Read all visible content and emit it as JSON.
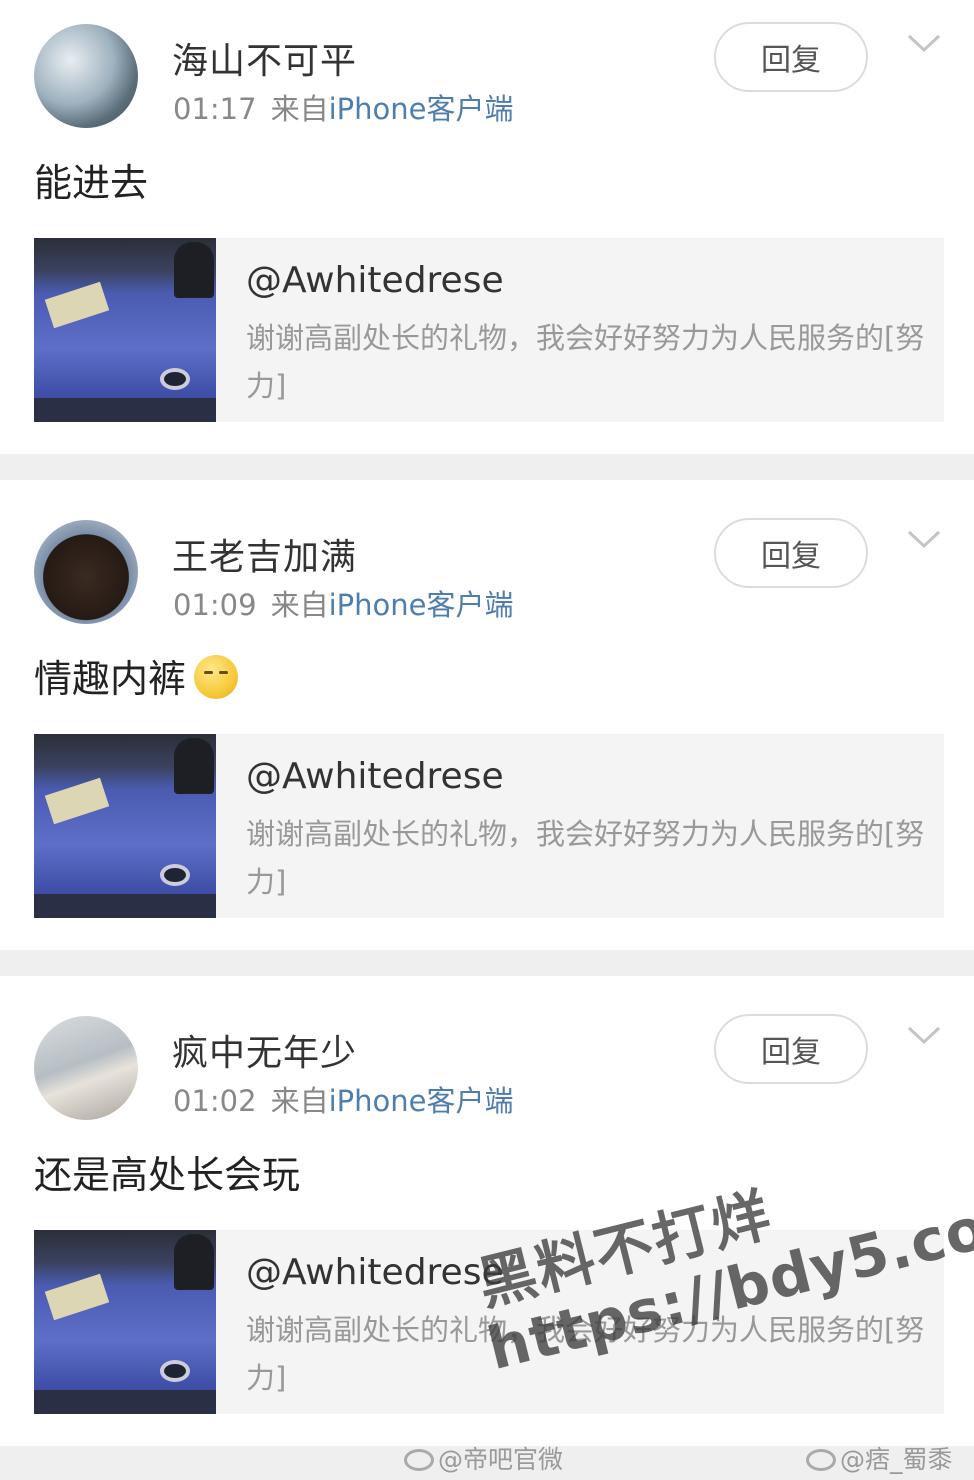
{
  "comments": [
    {
      "username": "海山不可平",
      "time": "01:17",
      "source_prefix": "来自",
      "source_app": "iPhone客户端",
      "reply_label": "回复",
      "content": "能进去",
      "quote": {
        "user": "@Awhitedrese",
        "text": "谢谢高副处长的礼物，我会好好努力为人民服务的[努力]"
      }
    },
    {
      "username": "王老吉加满",
      "time": "01:09",
      "source_prefix": "来自",
      "source_app": "iPhone客户端",
      "reply_label": "回复",
      "content": "情趣内裤",
      "emoji": "shushing-face",
      "quote": {
        "user": "@Awhitedrese",
        "text": "谢谢高副处长的礼物，我会好好努力为人民服务的[努力]"
      }
    },
    {
      "username": "疯中无年少",
      "time": "01:02",
      "source_prefix": "来自",
      "source_app": "iPhone客户端",
      "reply_label": "回复",
      "content": "还是高处长会玩",
      "quote": {
        "user": "@Awhitedrese",
        "text": "谢谢高副处长的礼物，我会好好努力为人民服务的[努力]"
      }
    }
  ],
  "watermark": {
    "line1": "黑料不打烊",
    "line2": "https://bdy5.co"
  },
  "footer": {
    "credit_left": "@帝吧官微",
    "credit_right": "@痞_蜀黍"
  },
  "colors": {
    "link": "#4f7eae",
    "divider": "#efefef",
    "quote_bg": "#f4f4f4"
  }
}
